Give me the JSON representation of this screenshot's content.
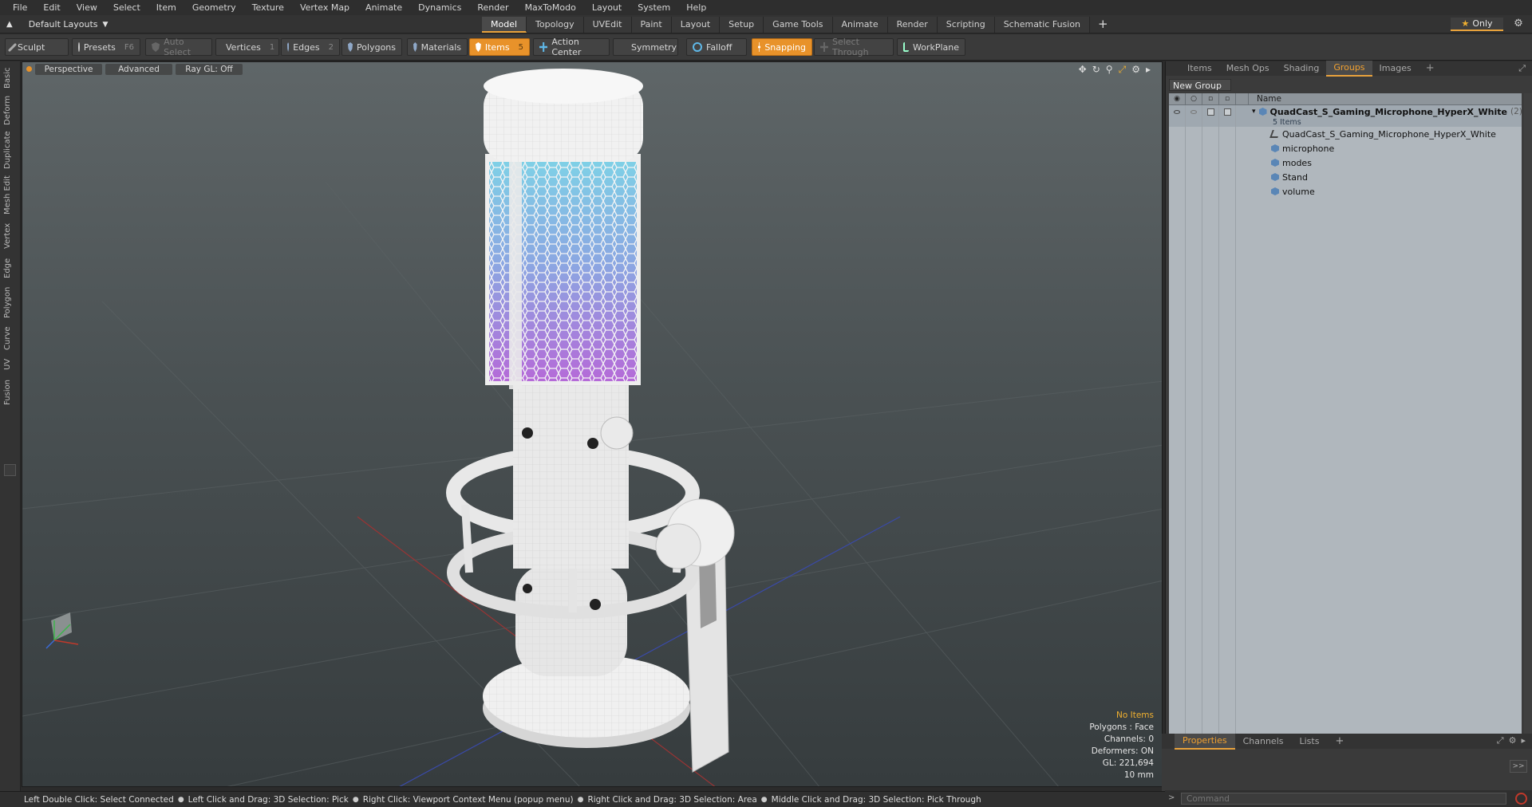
{
  "menu": [
    "File",
    "Edit",
    "View",
    "Select",
    "Item",
    "Geometry",
    "Texture",
    "Vertex Map",
    "Animate",
    "Dynamics",
    "Render",
    "MaxToModo",
    "Layout",
    "System",
    "Help"
  ],
  "layout_selector": "Default Layouts",
  "layout_tabs": [
    "Model",
    "Topology",
    "UVEdit",
    "Paint",
    "Layout",
    "Setup",
    "Game Tools",
    "Animate",
    "Render",
    "Scripting",
    "Schematic Fusion"
  ],
  "active_layout_tab": "Model",
  "only_label": "Only",
  "toolbar": {
    "sculpt": "Sculpt",
    "presets": "Presets",
    "presets_key": "F6",
    "auto_select": "Auto Select",
    "vertices": "Vertices",
    "vertices_count": "1",
    "edges": "Edges",
    "edges_count": "2",
    "polygons": "Polygons",
    "materials": "Materials",
    "items": "Items",
    "items_count": "5",
    "action_center": "Action Center",
    "symmetry": "Symmetry",
    "falloff": "Falloff",
    "snapping": "Snapping",
    "select_through": "Select Through",
    "workplane": "WorkPlane"
  },
  "left_tabs": [
    "Basic",
    "Deform",
    "Duplicate",
    "Mesh Edit",
    "Vertex",
    "Edge",
    "Polygon",
    "Curve",
    "UV",
    "Fusion"
  ],
  "viewport": {
    "view": "Perspective",
    "mode": "Advanced",
    "raygl": "Ray GL: Off",
    "info": {
      "no_items": "No Items",
      "polygons": "Polygons : Face",
      "channels": "Channels: 0",
      "deformers": "Deformers: ON",
      "gl": "GL: 221,694",
      "scale": "10 mm"
    }
  },
  "right_panel": {
    "tabs": [
      "Items",
      "Mesh Ops",
      "Shading",
      "Groups",
      "Images"
    ],
    "active_tab": "Groups",
    "new_group": "New Group",
    "column_name": "Name",
    "group": {
      "name": "QuadCast_S_Gaming_Microphone_HyperX_White",
      "count": "(2)",
      "sub": "5 Items",
      "children": [
        "QuadCast_S_Gaming_Microphone_HyperX_White",
        "microphone",
        "modes",
        "Stand",
        "volume"
      ]
    }
  },
  "lower_panel": {
    "tabs": [
      "Properties",
      "Channels",
      "Lists"
    ],
    "active_tab": "Properties"
  },
  "command_placeholder": "Command",
  "status": {
    "items": [
      "Left Double Click: Select Connected",
      "Left Click and Drag: 3D Selection: Pick",
      "Right Click: Viewport Context Menu (popup menu)",
      "Right Click and Drag: 3D Selection: Area",
      "Middle Click and Drag: 3D Selection: Pick Through"
    ]
  }
}
